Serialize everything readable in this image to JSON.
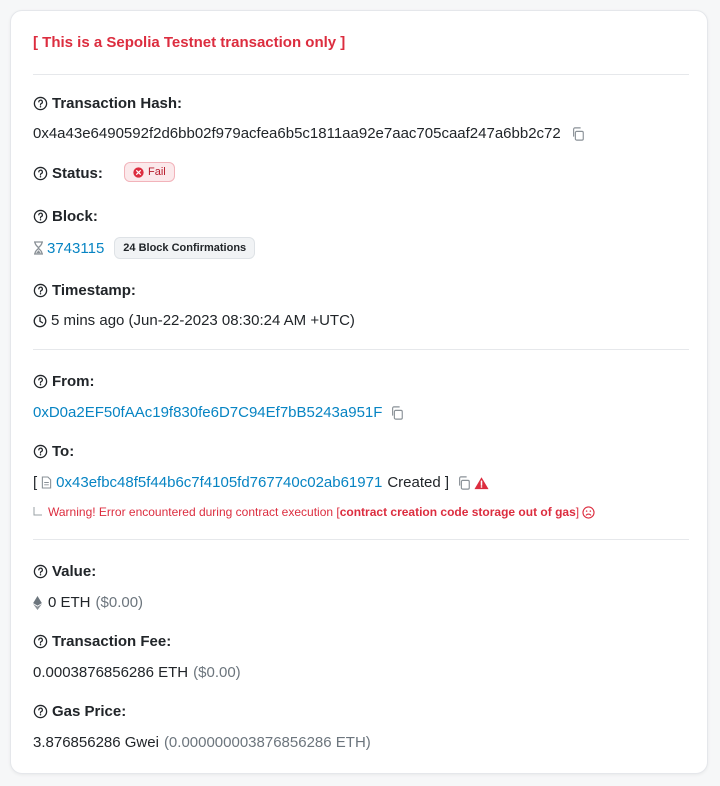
{
  "notice": "[ This is a Sepolia Testnet transaction only ]",
  "tx_hash": {
    "label": "Transaction Hash:",
    "value": "0x4a43e6490592f2d6bb02f979acfea6b5c1811aa92e7aac705caaf247a6bb2c72"
  },
  "status": {
    "label": "Status:",
    "badge": "Fail"
  },
  "block": {
    "label": "Block:",
    "number": "3743115",
    "confirmations": "24 Block Confirmations"
  },
  "timestamp": {
    "label": "Timestamp:",
    "value": "5 mins ago (Jun-22-2023 08:30:24 AM +UTC)"
  },
  "from": {
    "label": "From:",
    "address": "0xD0a2EF50fAAc19f830fe6D7C94Ef7bB5243a951F"
  },
  "to": {
    "label": "To:",
    "open_bracket": "[",
    "address": "0x43efbc48f5f44b6c7f4105fd767740c02ab61971",
    "created_text": "Created ]",
    "warning_prefix": "Warning! Error encountered during contract execution [",
    "warning_bold": "contract creation code storage out of gas",
    "warning_suffix": "]"
  },
  "value": {
    "label": "Value:",
    "amount": "0 ETH",
    "usd": "($0.00)"
  },
  "fee": {
    "label": "Transaction Fee:",
    "amount": "0.0003876856286 ETH",
    "usd": "($0.00)"
  },
  "gas_price": {
    "label": "Gas Price:",
    "amount": "3.876856286 Gwei",
    "eth": "(0.000000003876856286 ETH)"
  },
  "colors": {
    "link": "#0784c3",
    "danger": "#dc2d3f",
    "muted": "#6c757d"
  },
  "icons": {
    "help": "question-circle-icon",
    "copy": "copy-icon",
    "fail": "x-circle-icon",
    "block": "hourglass-icon",
    "clock": "clock-icon",
    "eth": "ethereum-icon",
    "file": "file-icon",
    "warning": "warning-triangle-icon",
    "sad": "frown-icon",
    "arrow": "corner-arrow-icon"
  }
}
